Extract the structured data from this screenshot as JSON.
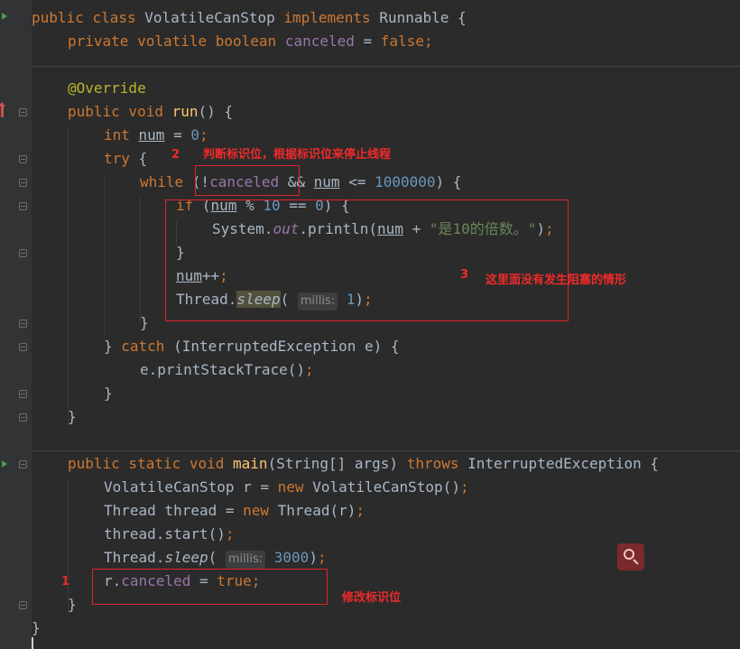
{
  "editor": {
    "lines": [
      {
        "id": "l1",
        "tokens": [
          [
            "kw",
            "public "
          ],
          [
            "kw",
            "class "
          ],
          [
            "plain",
            "VolatileCanStop "
          ],
          [
            "kw",
            "implements "
          ],
          [
            "plain",
            "Runnable {"
          ]
        ]
      },
      {
        "id": "l2",
        "tokens": [
          [
            "kw",
            "private volatile boolean "
          ],
          [
            "field",
            "canceled"
          ],
          [
            "plain",
            " = "
          ],
          [
            "kw",
            "false"
          ],
          [
            "kw",
            ";"
          ]
        ]
      },
      {
        "id": "l3",
        "tokens": [
          [
            "ann",
            "@Override"
          ]
        ]
      },
      {
        "id": "l4",
        "tokens": [
          [
            "kw",
            "public void "
          ],
          [
            "fn",
            "run"
          ],
          [
            "plain",
            "() {"
          ]
        ]
      },
      {
        "id": "l5",
        "tokens": [
          [
            "kw",
            "int "
          ],
          [
            "plain-ul",
            "num"
          ],
          [
            "plain",
            " = "
          ],
          [
            "num",
            "0"
          ],
          [
            "kw",
            ";"
          ]
        ]
      },
      {
        "id": "l6",
        "tokens": [
          [
            "kw",
            "try "
          ],
          [
            "plain",
            "{"
          ]
        ]
      },
      {
        "id": "l7",
        "tokens": [
          [
            "kw",
            "while "
          ],
          [
            "plain",
            "(!"
          ],
          [
            "field",
            "canceled"
          ],
          [
            "plain",
            " && "
          ],
          [
            "plain-ul",
            "num"
          ],
          [
            "plain",
            " <= "
          ],
          [
            "num",
            "1000000"
          ],
          [
            "plain",
            ") {"
          ]
        ]
      },
      {
        "id": "l8",
        "tokens": [
          [
            "kw",
            "if "
          ],
          [
            "plain",
            "("
          ],
          [
            "plain-ul",
            "num"
          ],
          [
            "plain",
            " % "
          ],
          [
            "num",
            "10"
          ],
          [
            "plain",
            " == "
          ],
          [
            "num",
            "0"
          ],
          [
            "plain",
            ") {"
          ]
        ]
      },
      {
        "id": "l9",
        "tokens": [
          [
            "plain",
            "System."
          ],
          [
            "field-it",
            "out"
          ],
          [
            "plain",
            ".println("
          ],
          [
            "plain-ul",
            "num"
          ],
          [
            "plain",
            " + "
          ],
          [
            "str",
            "\"是10的倍数。\""
          ],
          [
            "plain",
            ")"
          ],
          [
            "kw",
            ";"
          ]
        ]
      },
      {
        "id": "l10",
        "tokens": [
          [
            "plain",
            "}"
          ]
        ]
      },
      {
        "id": "l11",
        "tokens": [
          [
            "plain-ul",
            "num"
          ],
          [
            "plain",
            "++"
          ],
          [
            "kw",
            ";"
          ]
        ]
      },
      {
        "id": "l12",
        "tokens": [
          [
            "plain",
            "Thread."
          ],
          [
            "sleep-hl",
            "sleep"
          ],
          [
            "plain",
            "( "
          ],
          [
            "hint",
            "millis:"
          ],
          [
            "num",
            " 1"
          ],
          [
            "plain",
            ")"
          ],
          [
            "kw",
            ";"
          ]
        ]
      },
      {
        "id": "l13",
        "tokens": [
          [
            "plain",
            "}"
          ]
        ]
      },
      {
        "id": "l14",
        "tokens": [
          [
            "plain",
            "} "
          ],
          [
            "kw",
            "catch "
          ],
          [
            "plain",
            "(InterruptedException e) {"
          ]
        ]
      },
      {
        "id": "l15",
        "tokens": [
          [
            "plain",
            "e.printStackTrace()"
          ],
          [
            "kw",
            ";"
          ]
        ]
      },
      {
        "id": "l16",
        "tokens": [
          [
            "plain",
            "}"
          ]
        ]
      },
      {
        "id": "l17",
        "tokens": [
          [
            "plain",
            "}"
          ]
        ]
      },
      {
        "id": "l18",
        "tokens": [
          [
            "kw",
            "public static void "
          ],
          [
            "fn",
            "main"
          ],
          [
            "plain",
            "(String[] args) "
          ],
          [
            "kw",
            "throws "
          ],
          [
            "plain",
            "InterruptedException {"
          ]
        ]
      },
      {
        "id": "l19",
        "tokens": [
          [
            "plain",
            "VolatileCanStop r = "
          ],
          [
            "kw",
            "new "
          ],
          [
            "plain",
            "VolatileCanStop()"
          ],
          [
            "kw",
            ";"
          ]
        ]
      },
      {
        "id": "l20",
        "tokens": [
          [
            "plain",
            "Thread thread = "
          ],
          [
            "kw",
            "new "
          ],
          [
            "plain",
            "Thread(r)"
          ],
          [
            "kw",
            ";"
          ]
        ]
      },
      {
        "id": "l21",
        "tokens": [
          [
            "plain",
            "thread.start()"
          ],
          [
            "kw",
            ";"
          ]
        ]
      },
      {
        "id": "l22",
        "tokens": [
          [
            "plain",
            "Thread."
          ],
          [
            "static-it",
            "sleep"
          ],
          [
            "plain",
            "( "
          ],
          [
            "hint",
            "millis:"
          ],
          [
            "num",
            " 3000"
          ],
          [
            "plain",
            ")"
          ],
          [
            "kw",
            ";"
          ]
        ]
      },
      {
        "id": "l23",
        "tokens": [
          [
            "plain",
            "r."
          ],
          [
            "field",
            "canceled"
          ],
          [
            "plain",
            " = "
          ],
          [
            "kw",
            "true"
          ],
          [
            "kw",
            ";"
          ]
        ]
      },
      {
        "id": "l24",
        "tokens": [
          [
            "plain",
            "}"
          ]
        ]
      },
      {
        "id": "l25",
        "tokens": [
          [
            "plain",
            "}"
          ]
        ]
      }
    ]
  },
  "annotations": {
    "n1": "1",
    "n2": "2",
    "n3": "3",
    "note1": "修改标识位",
    "note2": "判断标识位，根据标识位来停止线程",
    "note3": "这里面没有发生阻塞的情形"
  },
  "colors": {
    "background": "#2b2b2b",
    "keyword": "#cc7832",
    "field": "#9876aa",
    "number": "#6897bb",
    "method": "#ffc66d",
    "annotation": "#bbb529",
    "string": "#6a8759",
    "highlight_box": "#e0222b"
  },
  "icons": {
    "search": "search-icon"
  }
}
